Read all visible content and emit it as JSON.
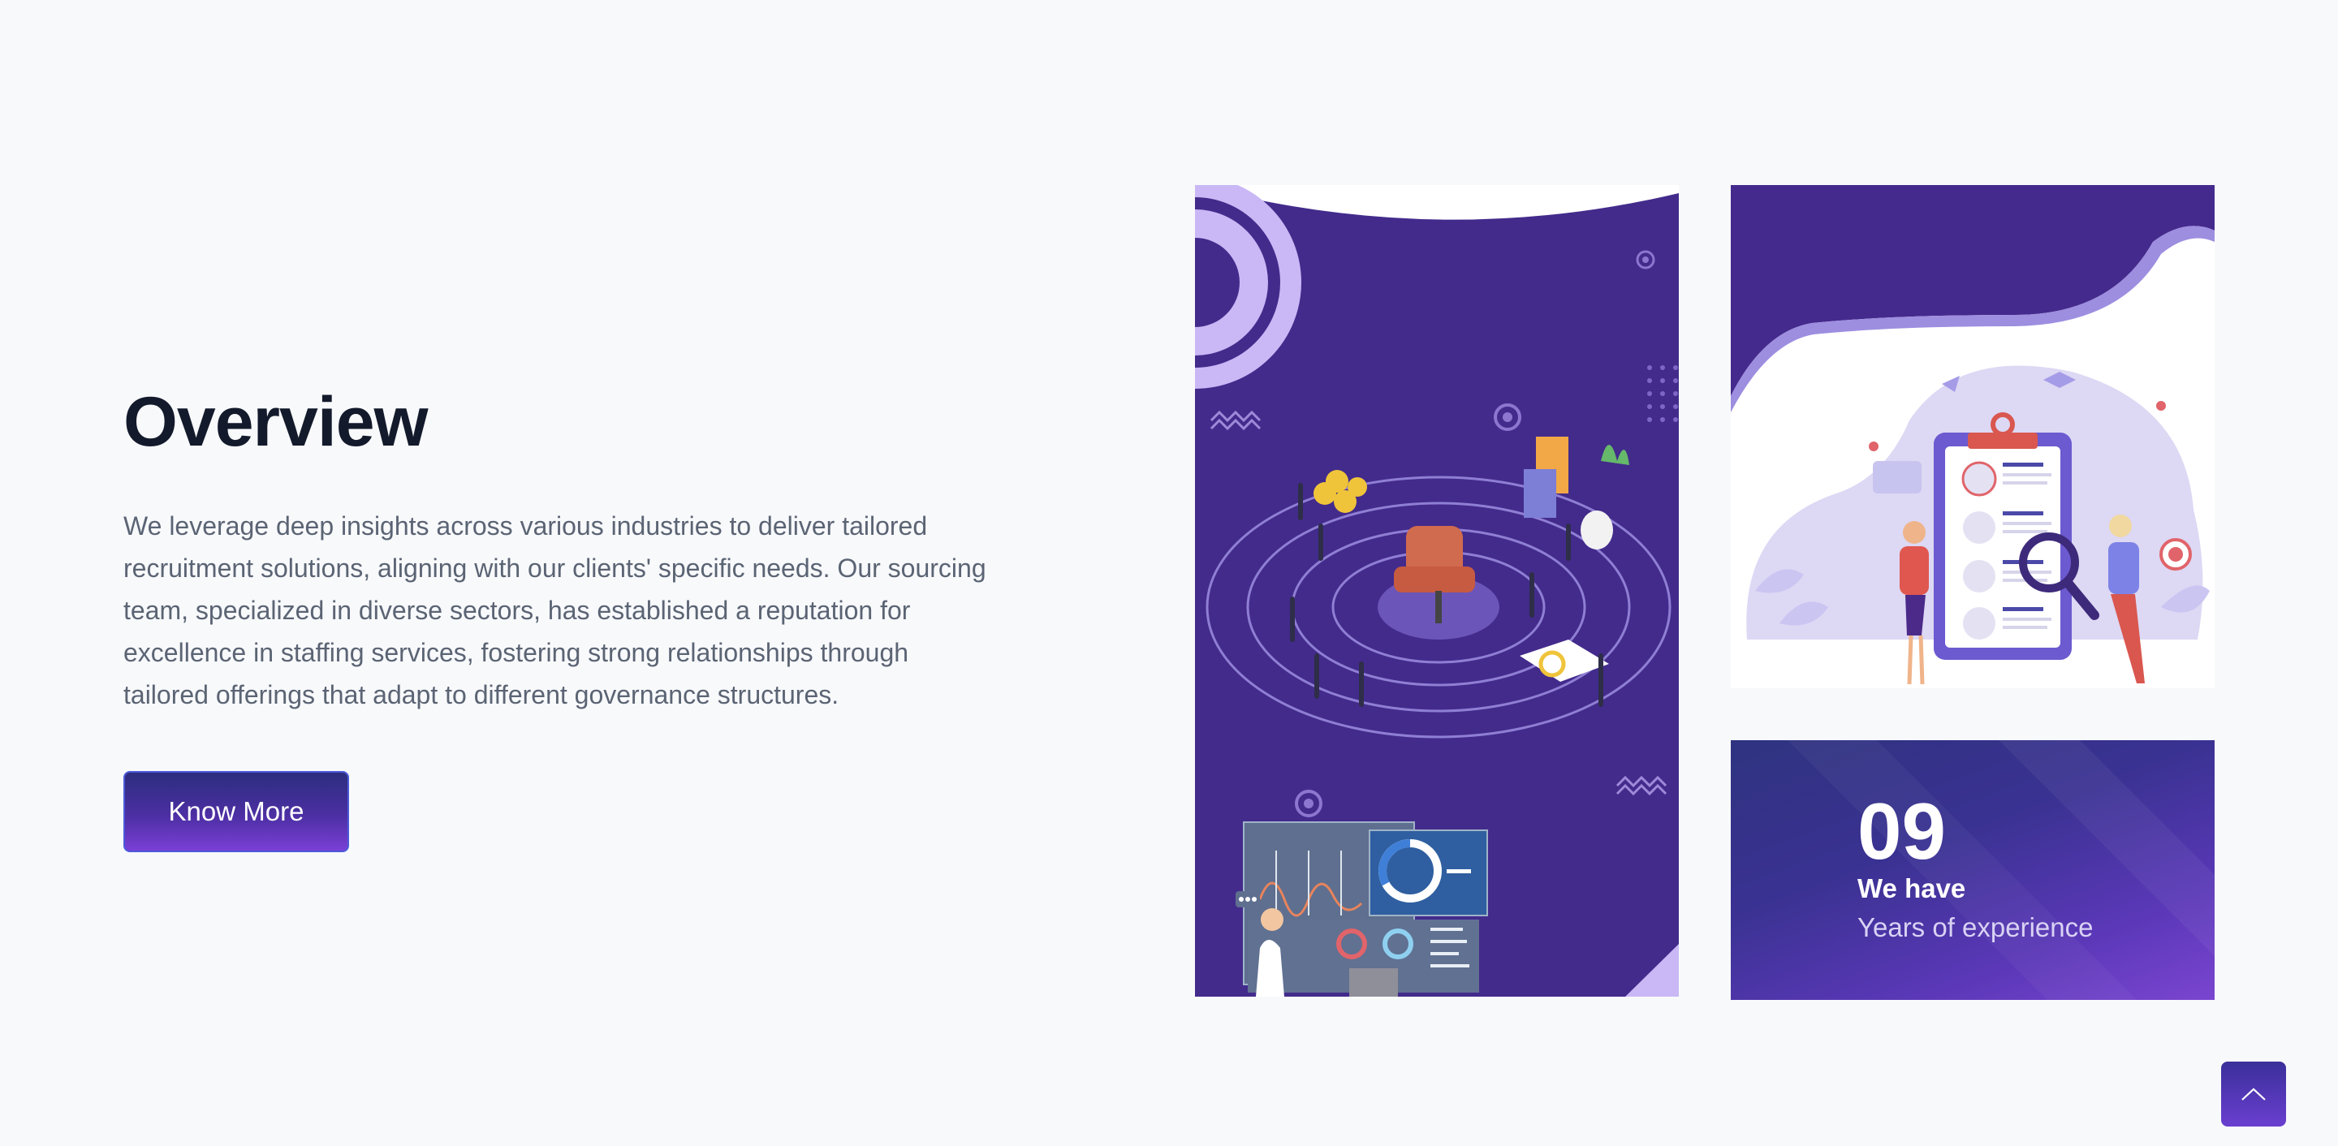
{
  "overview": {
    "title": "Overview",
    "description": "We leverage deep insights across various industries to deliver tailored recruitment solutions, aligning with our clients' specific needs. Our sourcing team, specialized in diverse sectors, has established a reputation for excellence in staffing services, fostering strong relationships through tailored offerings that adapt to different governance structures.",
    "button_label": "Know More"
  },
  "stats": {
    "number": "09",
    "line1": "We have",
    "line2": "Years of experience"
  },
  "colors": {
    "accent": "#432b8c",
    "accent_light": "#7a45d0",
    "text_dark": "#131a2b",
    "text_muted": "#5b6474"
  },
  "icons": {
    "scroll_top": "chevron-up-icon"
  }
}
